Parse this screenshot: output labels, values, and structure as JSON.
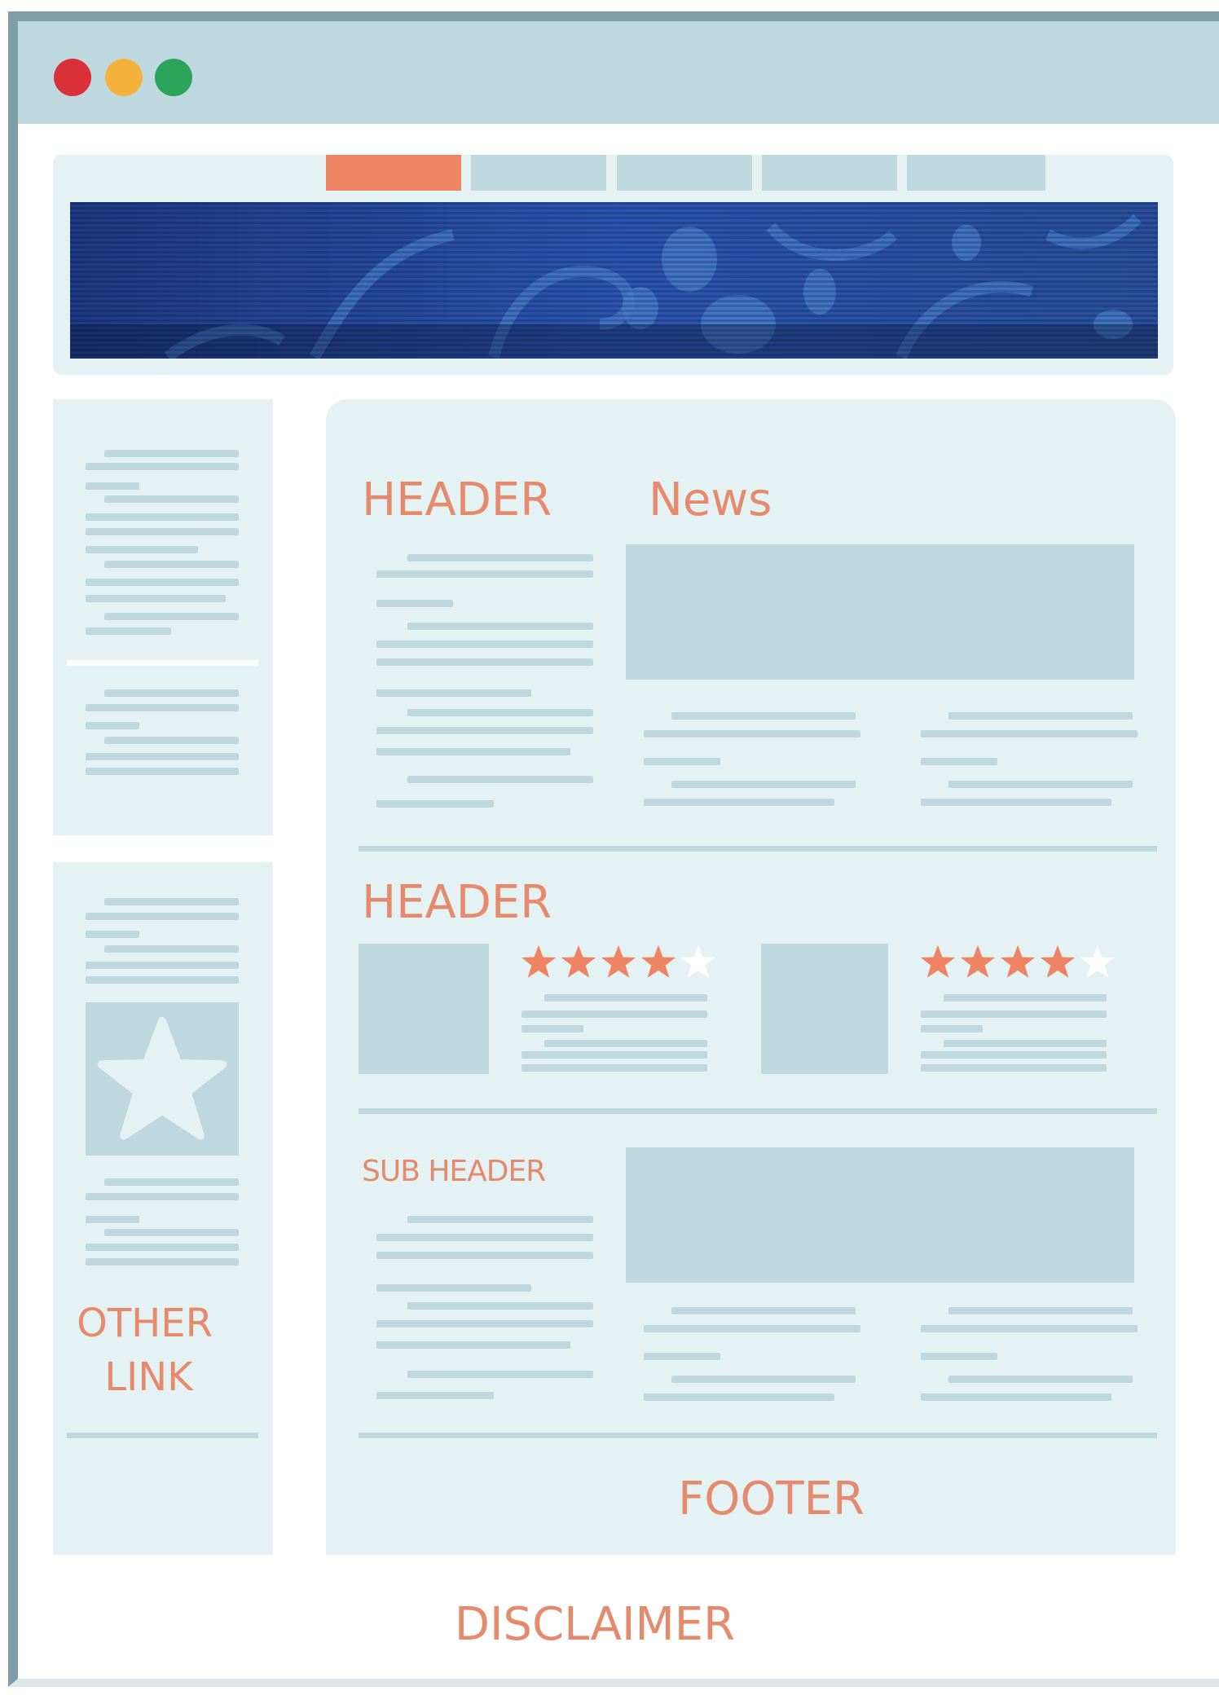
{
  "colors": {
    "frame": "#7f9ea5",
    "titlebar": "#bed8df",
    "panel": "#e4f2f4",
    "placeholder": "#bfd7de",
    "accent": "#ef8465",
    "label": "#e58a6c",
    "dot_red": "#d9303a",
    "dot_yellow": "#f4b23c",
    "dot_green": "#2aa45a",
    "banner": "#2a4ea0"
  },
  "window_controls": [
    "close-dot",
    "minimize-dot",
    "maximize-dot"
  ],
  "labels": {
    "header1": "HEADER",
    "news": "News",
    "header2": "HEADER",
    "sub_header": "SUB HEADER",
    "other_link_line1": "OTHER",
    "other_link_line2": "LINK",
    "footer": "FOOTER",
    "disclaimer": "DISCLAIMER"
  },
  "ratings": [
    {
      "filled": 4,
      "total": 5
    },
    {
      "filled": 4,
      "total": 5
    }
  ],
  "icons": [
    "star-icon"
  ]
}
